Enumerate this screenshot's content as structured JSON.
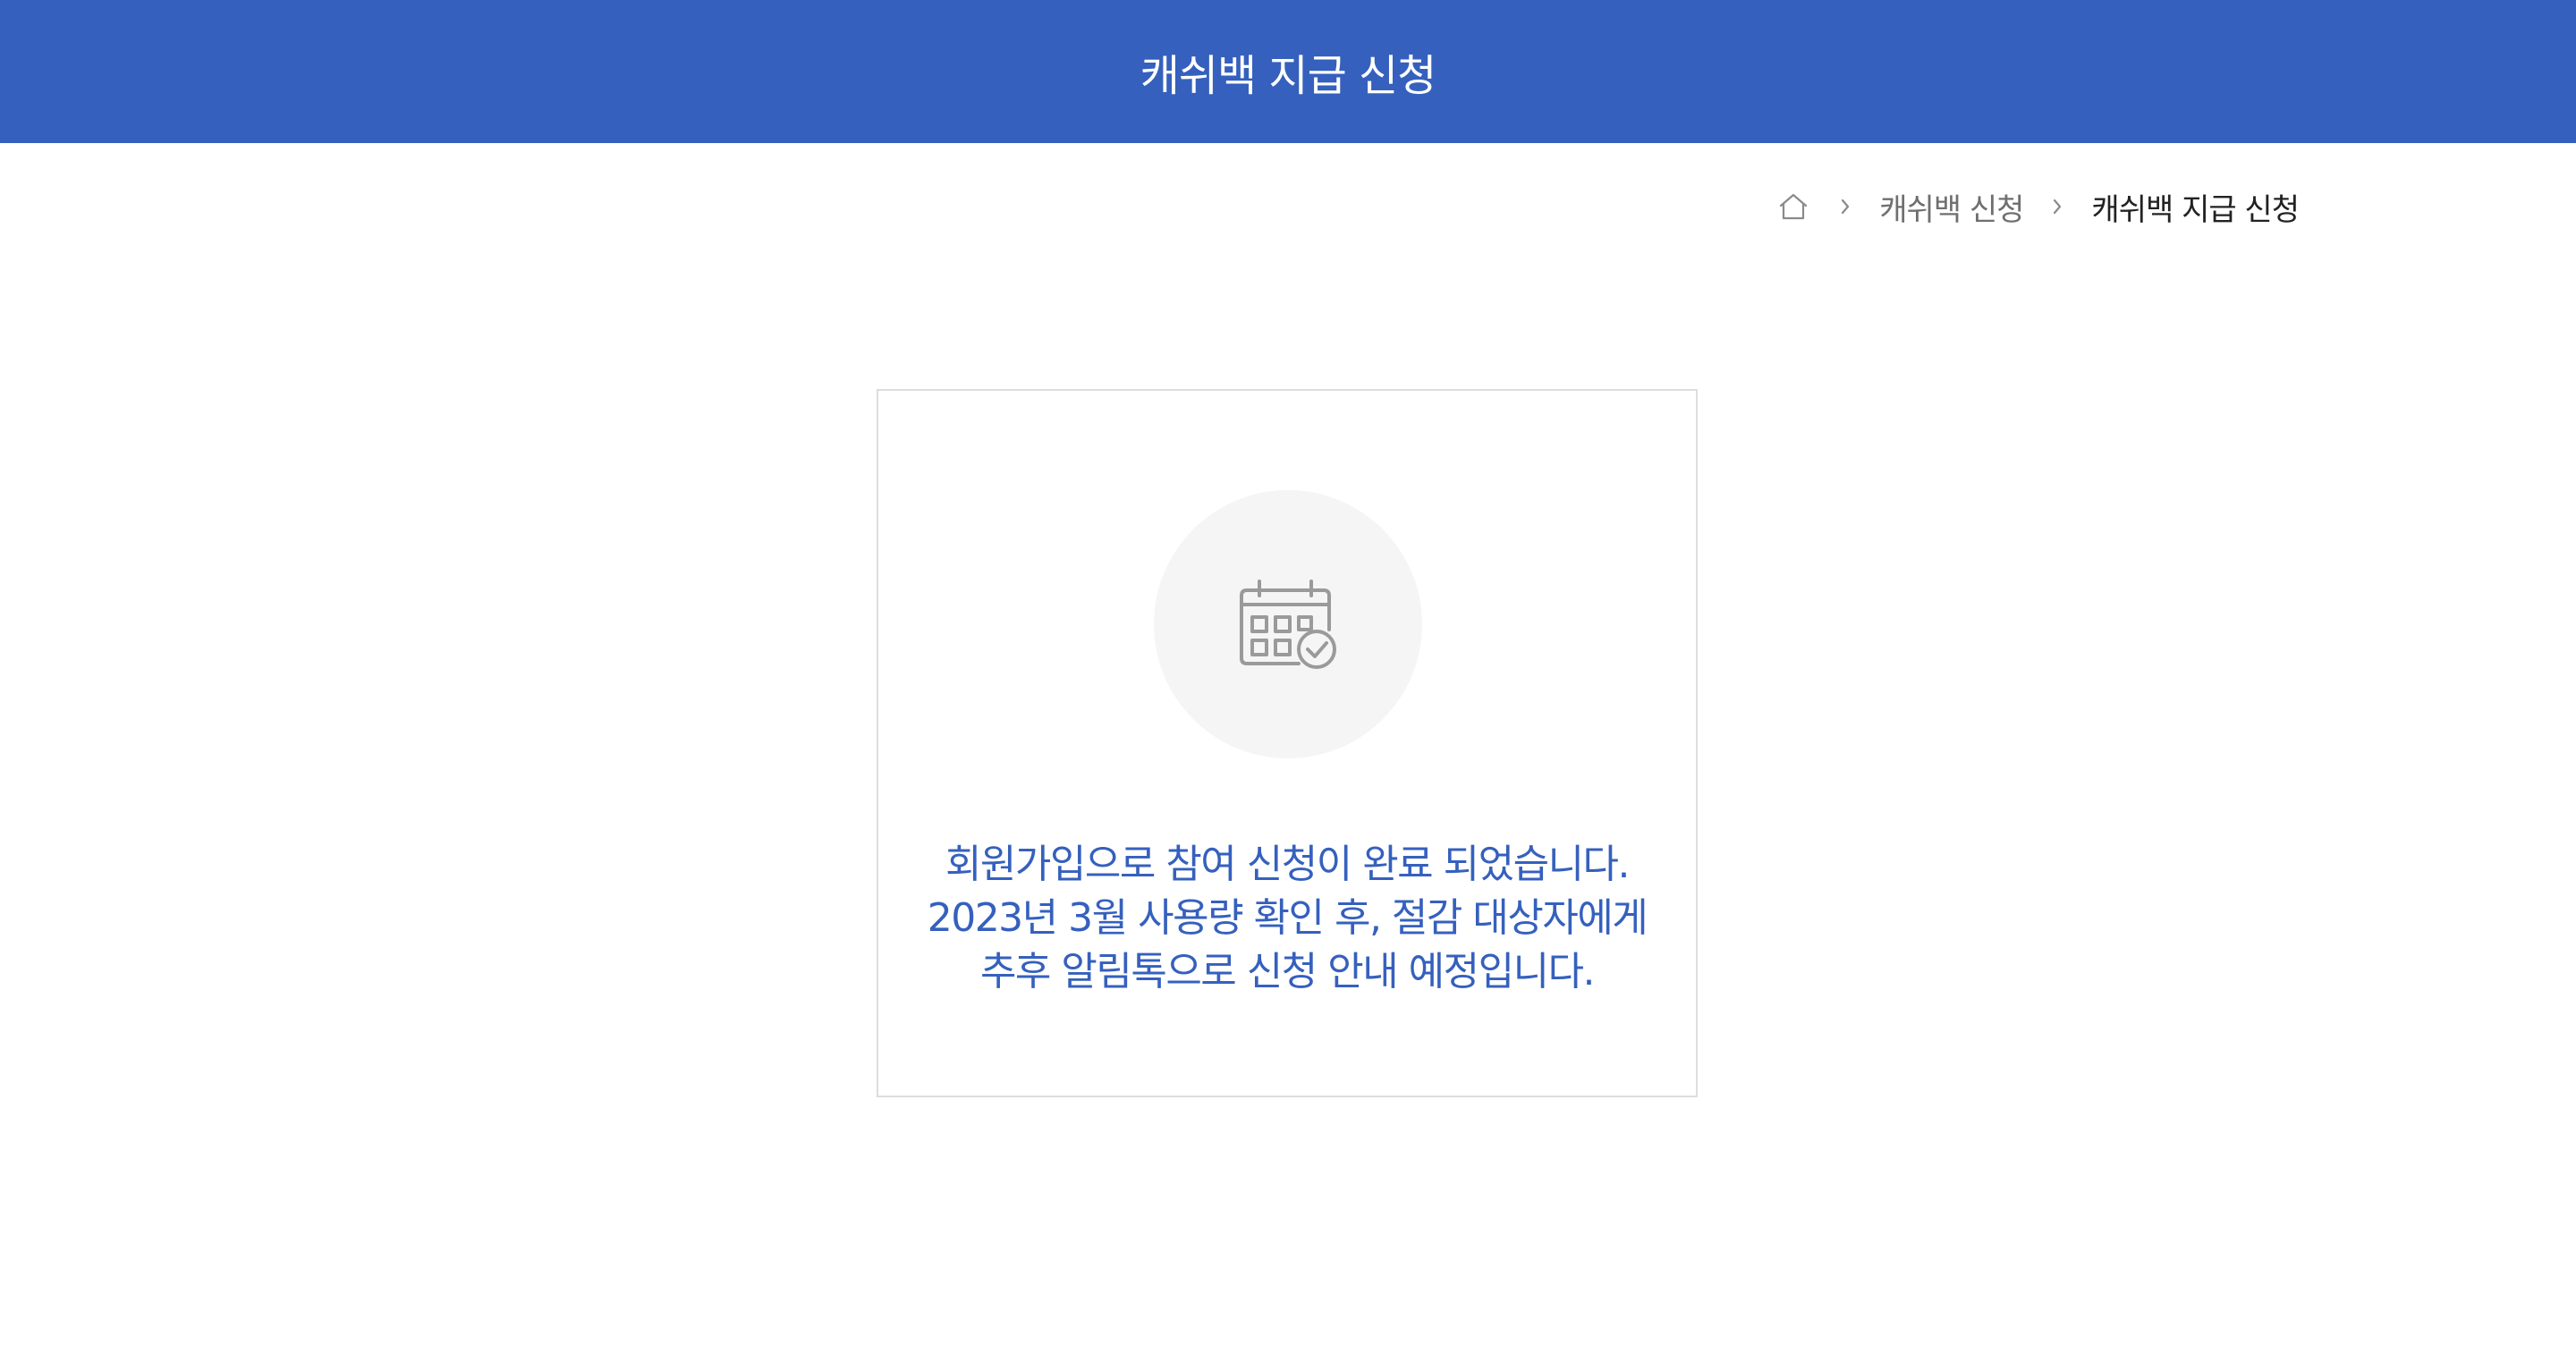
{
  "header": {
    "title": "캐쉬백 지급 신청"
  },
  "breadcrumb": {
    "home_icon": "home-icon",
    "separator_icon": "chevron-right-icon",
    "items": [
      {
        "label": "캐쉬백 신청"
      },
      {
        "label": "캐쉬백 지급 신청"
      }
    ]
  },
  "result": {
    "icon": "calendar-check-icon",
    "message_lines": [
      "회원가입으로 참여 신청이 완료 되었습니다.",
      "2023년 3월 사용량 확인 후, 절감 대상자에게",
      "추후 알림톡으로 신청 안내 예정입니다."
    ]
  },
  "colors": {
    "brand": "#3560bd",
    "card_border": "#dddddd",
    "icon_bg": "#f5f5f5",
    "icon_stroke": "#9a9a9a"
  }
}
